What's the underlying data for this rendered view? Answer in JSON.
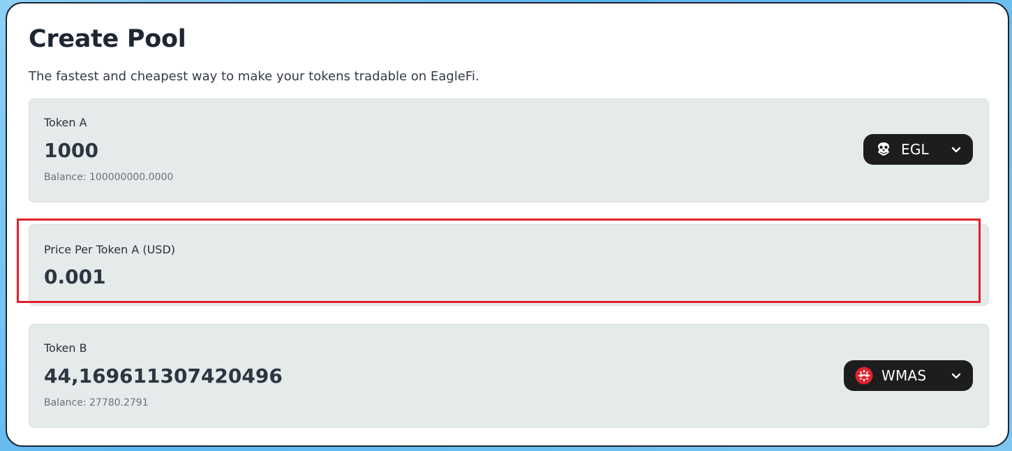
{
  "header": {
    "title": "Create Pool",
    "subtitle": "The fastest and cheapest way to make your tokens tradable on EagleFi."
  },
  "token_a": {
    "label": "Token A",
    "amount": "1000",
    "balance": "Balance: 100000000.0000",
    "selector": {
      "symbol": "EGL",
      "icon": "eagle-logo-icon"
    }
  },
  "price": {
    "label": "Price Per Token A (USD)",
    "value": "0.001",
    "highlight_color": "#e0202a"
  },
  "token_b": {
    "label": "Token B",
    "amount": "44,169611307420496",
    "balance": "Balance: 27780.2791",
    "selector": {
      "symbol": "WMAS",
      "icon": "massa-logo-icon"
    }
  },
  "colors": {
    "selector_bg": "#1d1d1f",
    "panel_bg": "#e5eaea",
    "wmas_brand": "#e0202a"
  }
}
